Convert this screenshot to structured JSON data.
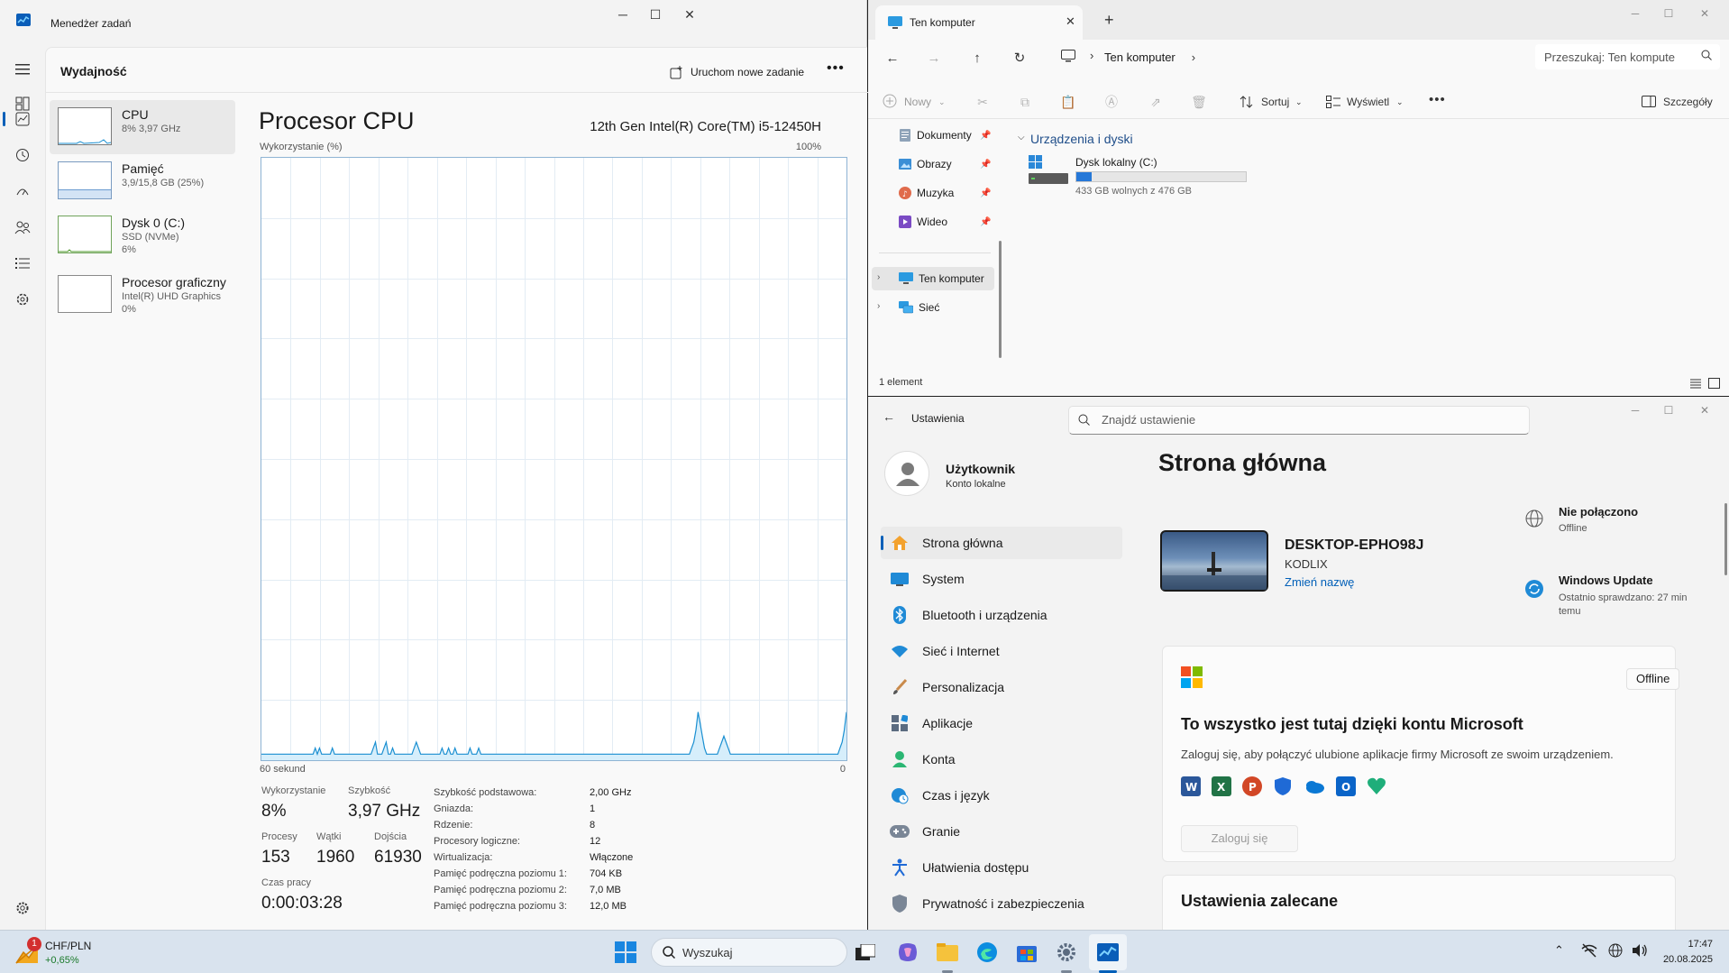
{
  "task_manager": {
    "title": "Menedżer zadań",
    "page_title": "Wydajność",
    "run_new_task": "Uruchom nowe zadanie",
    "more": "•••",
    "perf_items": [
      {
        "name": "CPU",
        "sub1": "8% 3,97 GHz",
        "sub2": ""
      },
      {
        "name": "Pamięć",
        "sub1": "3,9/15,8 GB (25%)",
        "sub2": ""
      },
      {
        "name": "Dysk 0 (C:)",
        "sub1": "SSD (NVMe)",
        "sub2": "6%"
      },
      {
        "name": "Procesor graficzny",
        "sub1": "Intel(R) UHD Graphics",
        "sub2": "0%"
      }
    ],
    "memory_fill_fraction": 0.25,
    "cpu": {
      "title": "Procesor CPU",
      "model": "12th Gen Intel(R) Core(TM) i5-12450H",
      "graph_label": "Wykorzystanie (%)",
      "graph_max": "100%",
      "graph_x_left": "60 sekund",
      "graph_x_right": "0",
      "utilization_history": [
        1,
        1,
        1,
        1,
        1,
        1,
        1,
        1,
        1,
        1,
        1,
        1,
        1,
        1,
        1,
        1,
        1,
        1,
        1,
        1,
        1,
        1,
        1,
        1,
        1,
        2,
        1,
        2,
        1,
        1,
        1,
        1,
        1,
        2,
        1,
        1,
        1,
        1,
        1,
        1,
        1,
        1,
        1,
        1,
        1,
        1,
        1,
        1,
        1,
        1,
        1,
        1,
        2,
        3,
        1,
        1,
        1,
        2,
        3,
        1,
        1,
        2,
        1,
        1,
        1,
        1,
        1,
        1,
        1,
        1,
        1,
        2,
        3,
        2,
        1,
        1,
        1,
        1,
        1,
        1,
        1,
        1,
        1,
        1,
        2,
        1,
        1,
        2,
        1,
        1,
        2,
        1,
        1,
        1,
        1,
        1,
        1,
        2,
        1,
        1,
        1,
        2,
        1,
        1,
        1,
        1,
        1,
        1,
        1,
        1,
        1,
        1,
        1,
        1,
        1,
        1,
        1,
        1,
        1,
        1,
        1,
        1,
        1,
        1,
        1,
        1,
        1,
        1,
        1,
        1,
        1,
        1,
        1,
        1,
        1,
        1,
        1,
        1,
        1,
        1,
        1,
        1,
        1,
        1,
        1,
        1,
        1,
        1,
        1,
        1,
        1,
        1,
        1,
        1,
        1,
        1,
        1,
        1,
        1,
        1,
        1,
        1,
        1,
        1,
        1,
        1,
        1,
        1,
        1,
        1,
        1,
        1,
        1,
        1,
        1,
        1,
        1,
        1,
        1,
        1,
        1,
        1,
        1,
        1,
        1,
        1,
        1,
        1,
        1,
        1,
        1,
        1,
        1,
        1,
        1,
        1,
        1,
        1,
        1,
        1,
        2,
        3,
        5,
        8,
        6,
        4,
        2,
        1,
        1,
        1,
        1,
        1,
        1,
        2,
        3,
        4,
        3,
        2,
        1,
        1,
        1,
        1,
        1,
        1,
        1,
        1,
        1,
        1,
        1,
        1,
        1,
        1,
        1,
        1,
        1,
        1,
        1,
        1,
        1,
        1,
        1,
        1,
        1,
        1,
        1,
        1,
        1,
        1,
        1,
        1,
        1,
        1,
        1,
        1,
        1,
        1,
        1,
        1,
        1,
        1,
        1,
        1,
        1,
        1,
        1,
        1,
        1,
        1,
        1,
        2,
        3,
        5,
        8
      ],
      "stats": {
        "utilization_label": "Wykorzystanie",
        "utilization": "8%",
        "speed_label": "Szybkość",
        "speed": "3,97 GHz",
        "processes_label": "Procesy",
        "processes": "153",
        "threads_label": "Wątki",
        "threads": "1960",
        "handles_label": "Dojścia",
        "handles": "61930",
        "uptime_label": "Czas pracy",
        "uptime": "0:00:03:28"
      },
      "specs": [
        {
          "k": "Szybkość podstawowa:",
          "v": "2,00 GHz"
        },
        {
          "k": "Gniazda:",
          "v": "1"
        },
        {
          "k": "Rdzenie:",
          "v": "8"
        },
        {
          "k": "Procesory logiczne:",
          "v": "12"
        },
        {
          "k": "Wirtualizacja:",
          "v": "Włączone"
        },
        {
          "k": "Pamięć podręczna poziomu 1:",
          "v": "704 KB"
        },
        {
          "k": "Pamięć podręczna poziomu 2:",
          "v": "7,0 MB"
        },
        {
          "k": "Pamięć podręczna poziomu 3:",
          "v": "12,0 MB"
        }
      ]
    }
  },
  "explorer": {
    "tab_title": "Ten komputer",
    "address": "Ten komputer",
    "search_placeholder": "Przeszukaj: Ten kompute",
    "toolbar": {
      "new": "Nowy",
      "sort": "Sortuj",
      "view": "Wyświetl",
      "details": "Szczegóły"
    },
    "quick_access": [
      "Dokumenty",
      "Obrazy",
      "Muzyka",
      "Wideo"
    ],
    "tree": [
      "Ten komputer",
      "Sieć"
    ],
    "group_header": "Urządzenia i dyski",
    "drive": {
      "name": "Dysk lokalny (C:)",
      "space": "433 GB wolnych z 476 GB",
      "used_fraction": 0.09
    },
    "status": "1 element"
  },
  "settings": {
    "app_title": "Ustawienia",
    "search_placeholder": "Znajdź ustawienie",
    "user_name": "Użytkownik",
    "user_type": "Konto lokalne",
    "nav": [
      "Strona główna",
      "System",
      "Bluetooth i urządzenia",
      "Sieć i Internet",
      "Personalizacja",
      "Aplikacje",
      "Konta",
      "Czas i język",
      "Granie",
      "Ułatwienia dostępu",
      "Prywatność i zabezpieczenia"
    ],
    "page_title": "Strona główna",
    "device_name": "DESKTOP-EPHO98J",
    "device_model": "KODLIX",
    "rename": "Zmień nazwę",
    "network_title": "Nie połączono",
    "network_sub": "Offline",
    "update_title": "Windows Update",
    "update_sub": "Ostatnio sprawdzano: 27 min temu",
    "ms_badge": "Offline",
    "ms_title": "To wszystko jest tutaj dzięki kontu Microsoft",
    "ms_desc": "Zaloguj się, aby połączyć ulubione aplikacje firmy Microsoft ze swoim urządzeniem.",
    "sign_in": "Zaloguj się",
    "recommended": "Ustawienia zalecane"
  },
  "taskbar": {
    "widget_badge": "1",
    "widget_title": "CHF/PLN",
    "widget_value": "+0,65%",
    "search": "Wyszukaj",
    "time": "17:47",
    "date": "20.08.2025"
  }
}
